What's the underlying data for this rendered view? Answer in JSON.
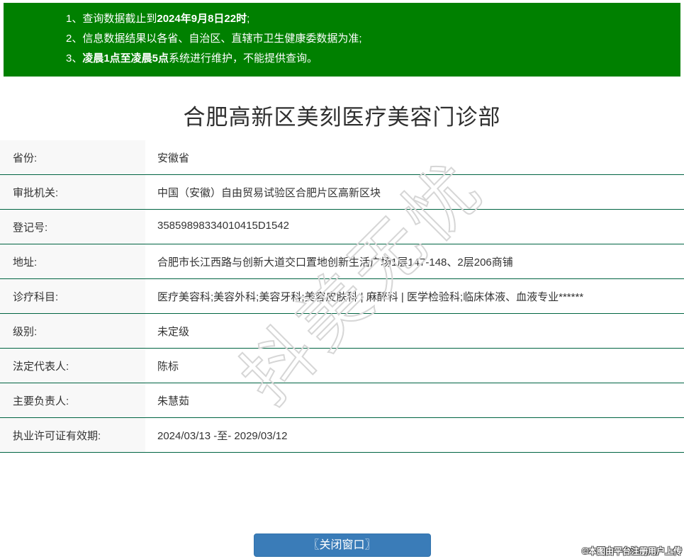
{
  "notice": {
    "bg_color": "#008000",
    "items": [
      {
        "num": "1、",
        "pre": "查询数据截止到",
        "bold": "2024年9月8日22时",
        "post": ";"
      },
      {
        "num": "2、",
        "pre": "信息数据结果以各省、自治区、直辖市卫生健康委数据为准;",
        "bold": "",
        "post": ""
      },
      {
        "num": "3、",
        "pre": "",
        "bold": "凌晨1点至凌晨5点",
        "post": "系统进行维护，不能提供查询。"
      }
    ]
  },
  "title": "合肥高新区美刻医疗美容门诊部",
  "table": {
    "divider_color": "#006442",
    "rows": [
      {
        "label": "省份:",
        "value": "安徽省"
      },
      {
        "label": "审批机关:",
        "value": "中国（安徽）自由贸易试验区合肥片区高新区块"
      },
      {
        "label": "登记号:",
        "value": "35859898334010415D1542"
      },
      {
        "label": "地址:",
        "value": "合肥市长江西路与创新大道交口置地创新生活广场1层147-148、2层206商铺"
      },
      {
        "label": "诊疗科目:",
        "value": "医疗美容科;美容外科;美容牙科;美容皮肤科 | 麻醉科 | 医学检验科;临床体液、血液专业******"
      },
      {
        "label": "级别:",
        "value": "未定级"
      },
      {
        "label": "法定代表人:",
        "value": "陈标"
      },
      {
        "label": "主要负责人:",
        "value": "朱慧茹"
      },
      {
        "label": "执业许可证有效期:",
        "value": "2024/03/13 -至- 2029/03/12"
      }
    ]
  },
  "footer": {
    "close_button_label": "〖关闭窗口〗",
    "button_color": "#3a7cb8",
    "credit": "©本图由平台注册用户上传"
  },
  "watermark": {
    "diagonal_text": "抖美无忧"
  }
}
